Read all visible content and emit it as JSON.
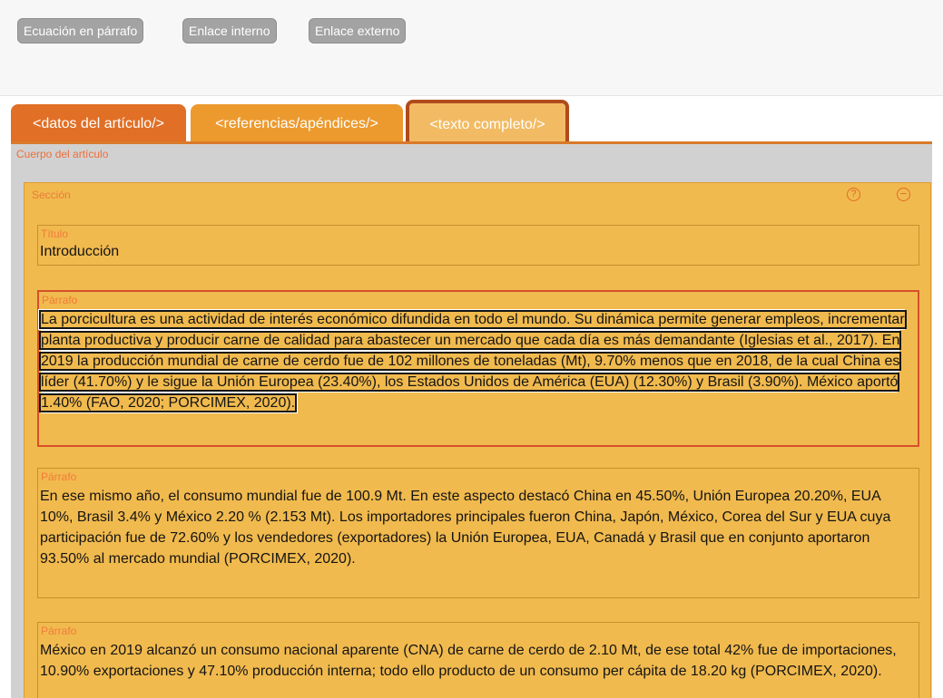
{
  "toolbar": {
    "buttons": [
      "Ecuación en párrafo",
      "Enlace interno",
      "Enlace externo"
    ]
  },
  "tabs": [
    {
      "label": "<datos del artículo/>"
    },
    {
      "label": "<referencias/apéndices/>"
    },
    {
      "label": "<texto completo/>",
      "active": true
    }
  ],
  "body": {
    "label": "Cuerpo del artículo",
    "section": {
      "label": "Sección",
      "help_icon": "?",
      "collapse_icon": "⊖",
      "title": {
        "label": "Título",
        "value": "Introducción"
      },
      "paragraphs": [
        {
          "label": "Párrafo",
          "text": "La porcicultura es una actividad de interés económico difundida en todo el mundo. Su dinámica permite generar empleos, incrementar planta productiva y producir carne de calidad para abastecer un mercado que cada día es más demandante (Iglesias et al., 2017). En 2019 la producción mundial de carne de cerdo fue de 102 millones de toneladas (Mt), 9.70% menos que en 2018, de la cual China es líder (41.70%) y le sigue la Unión Europea (23.40%), los Estados Unidos de América (EUA) (12.30%) y Brasil (3.90%). México aportó 1.40% (FAO, 2020; PORCIMEX, 2020)."
        },
        {
          "label": "Párrafo",
          "text": "En ese mismo año, el consumo mundial fue de 100.9 Mt. En este aspecto destacó China en 45.50%, Unión Europea 20.20%, EUA 10%, Brasil 3.4% y México 2.20 % (2.153 Mt). Los importadores principales fueron China, Japón, México, Corea del Sur y EUA cuya participación fue de 72.60% y los vendedores (exportadores) la Unión Europea, EUA, Canadá y Brasil que en conjunto aportaron 93.50% al mercado mundial (PORCIMEX, 2020)."
        },
        {
          "label": "Párrafo",
          "text": "México en 2019 alcanzó un consumo nacional aparente (CNA) de carne de cerdo de 2.10 Mt, de ese total 42% fue de importaciones, 10.90% exportaciones y 47.10% producción interna; todo ello producto de un consumo per cápita de 18.20 kg (PORCIMEX, 2020)."
        }
      ]
    }
  },
  "colors": {
    "tab_datos": "#e16f25",
    "tab_refs": "#ec9a2e",
    "tab_texto": "#f2bb63",
    "section_bg": "#f1ba4e",
    "label_orange": "#ee6e3a"
  }
}
